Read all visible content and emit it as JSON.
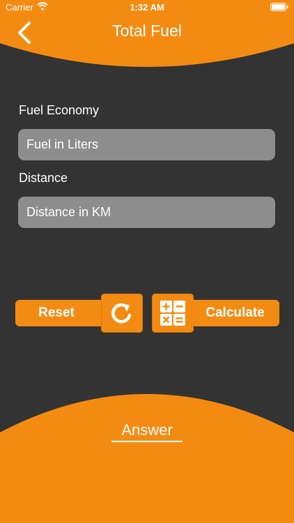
{
  "status_bar": {
    "carrier": "Carrier",
    "time": "1:32 AM",
    "icons": [
      "wifi-icon",
      "battery-icon"
    ]
  },
  "nav": {
    "title": "Total Fuel",
    "back_icon": "chevron-left-icon"
  },
  "form": {
    "fuel_economy_label": "Fuel Economy",
    "fuel_placeholder": "Fuel in Liters",
    "fuel_value": "",
    "distance_label": "Distance",
    "distance_placeholder": "Distance in KM",
    "distance_value": ""
  },
  "actions": {
    "reset_label": "Reset",
    "reset_icon": "refresh-icon",
    "calculate_label": "Calculate",
    "calculate_icon": "calculator-icon"
  },
  "result": {
    "answer_label": "Answer"
  },
  "colors": {
    "accent": "#F38B12",
    "background": "#333333",
    "input_fill": "#8D8D8D",
    "text": "#FFFFFF"
  }
}
